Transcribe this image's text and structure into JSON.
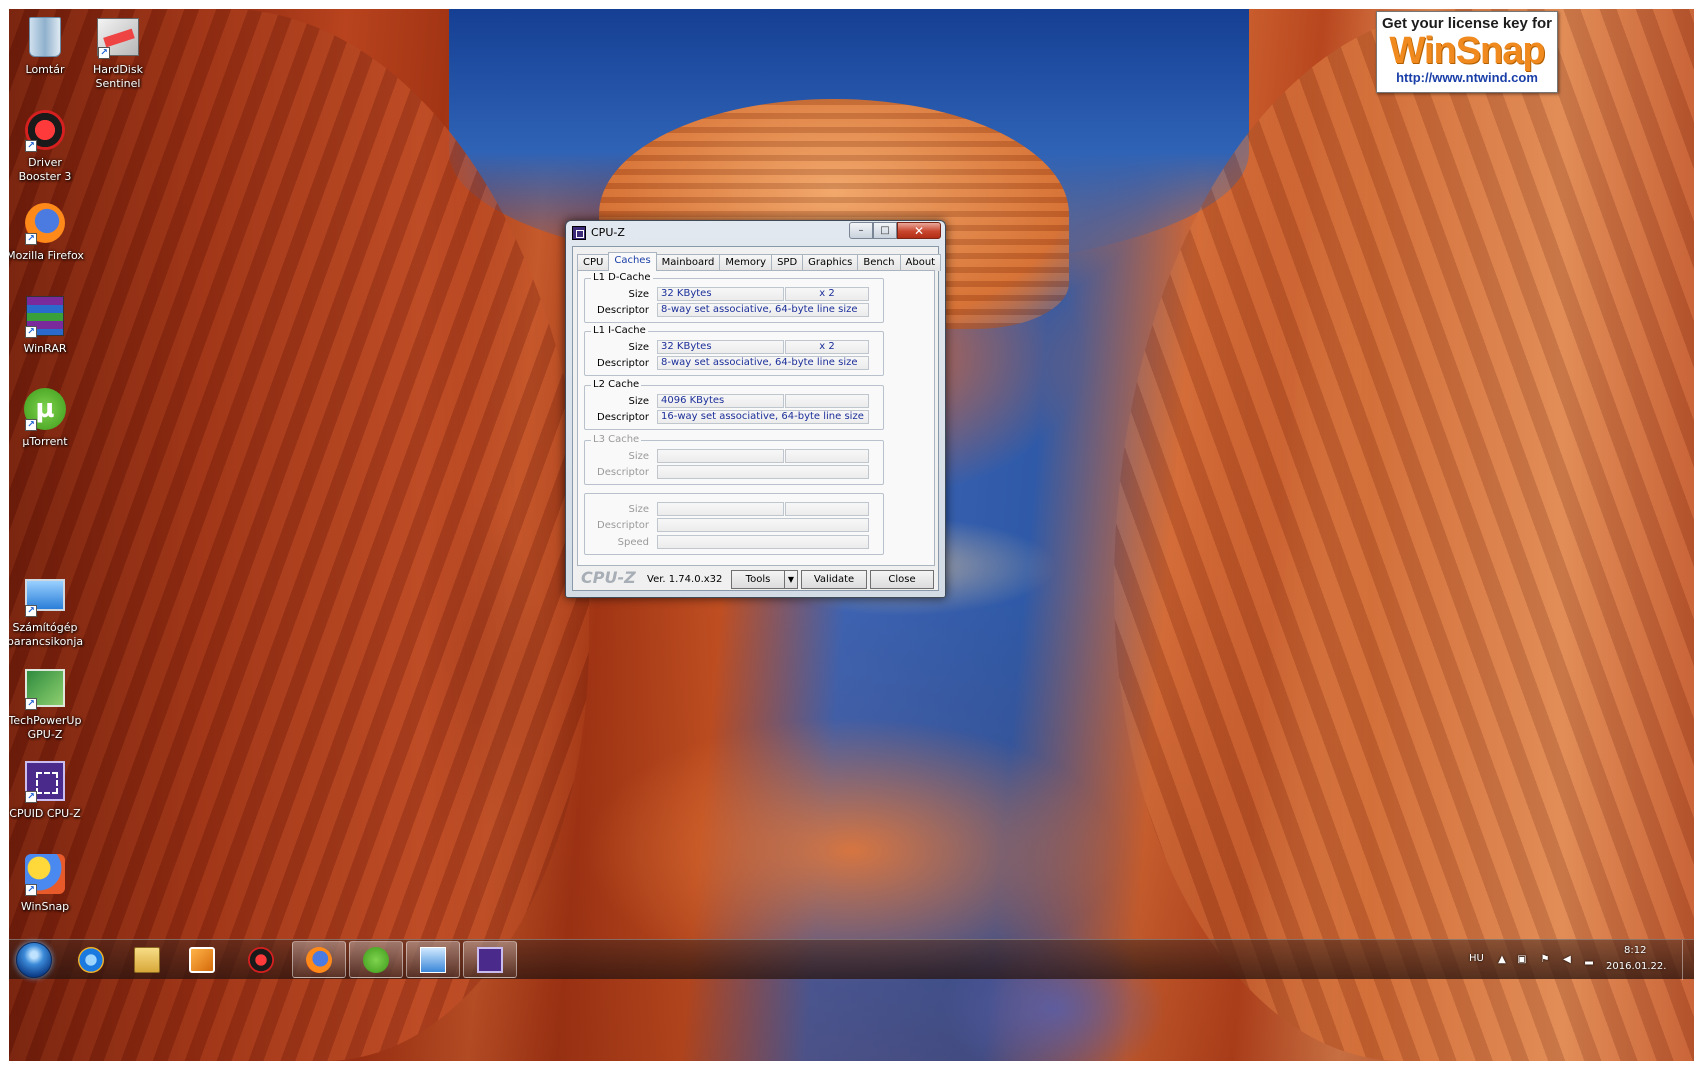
{
  "desktop": {
    "icons": [
      {
        "label": "Lomtár",
        "icon": "recycle-bin-icon"
      },
      {
        "label": "HardDisk Sentinel",
        "icon": "harddisk-sentinel-icon"
      },
      {
        "label": "Driver Booster 3",
        "icon": "driver-booster-icon"
      },
      {
        "label": "Mozilla Firefox",
        "icon": "firefox-icon"
      },
      {
        "label": "WinRAR",
        "icon": "winrar-icon"
      },
      {
        "label": "µTorrent",
        "icon": "utorrent-icon"
      },
      {
        "label": "Számítógép parancsikonja",
        "icon": "computer-icon"
      },
      {
        "label": "TechPowerUp GPU-Z",
        "icon": "gpu-z-icon"
      },
      {
        "label": "CPUID CPU-Z",
        "icon": "cpu-z-icon"
      },
      {
        "label": "WinSnap",
        "icon": "winsnap-icon"
      }
    ]
  },
  "ad": {
    "top": "Get your license key for",
    "brand": "WinSnap",
    "url": "http://www.ntwind.com"
  },
  "cpuz": {
    "title": "CPU-Z",
    "window_buttons": {
      "minimize": "–",
      "maximize": "□",
      "close": "✕"
    },
    "tabs": [
      "CPU",
      "Caches",
      "Mainboard",
      "Memory",
      "SPD",
      "Graphics",
      "Bench",
      "About"
    ],
    "active_tab": "Caches",
    "groups": {
      "l1d": {
        "label": "L1 D-Cache",
        "size_label": "Size",
        "size": "32 KBytes",
        "multiplier": "x 2",
        "descriptor_label": "Descriptor",
        "descriptor": "8-way set associative, 64-byte line size"
      },
      "l1i": {
        "label": "L1 I-Cache",
        "size_label": "Size",
        "size": "32 KBytes",
        "multiplier": "x 2",
        "descriptor_label": "Descriptor",
        "descriptor": "8-way set associative, 64-byte line size"
      },
      "l2": {
        "label": "L2 Cache",
        "size_label": "Size",
        "size": "4096 KBytes",
        "multiplier": "",
        "descriptor_label": "Descriptor",
        "descriptor": "16-way set associative, 64-byte line size"
      },
      "l3": {
        "label": "L3 Cache",
        "size_label": "Size",
        "size": "",
        "multiplier": "",
        "descriptor_label": "Descriptor",
        "descriptor": ""
      },
      "extra": {
        "size_label": "Size",
        "descriptor_label": "Descriptor",
        "speed_label": "Speed"
      }
    },
    "footer": {
      "brand": "CPU-Z",
      "version": "Ver. 1.74.0.x32",
      "tools": "Tools",
      "tools_dropdown": "▼",
      "validate": "Validate",
      "close": "Close"
    }
  },
  "taskbar": {
    "pinned": [
      {
        "name": "internet-explorer-icon"
      },
      {
        "name": "file-explorer-icon"
      },
      {
        "name": "media-player-icon"
      },
      {
        "name": "driver-booster-icon"
      },
      {
        "name": "firefox-icon"
      },
      {
        "name": "utorrent-icon"
      },
      {
        "name": "remote-desktop-icon"
      },
      {
        "name": "cpu-z-icon"
      }
    ],
    "tray": {
      "language": "HU",
      "time": "8:12",
      "date": "2016.01.22."
    }
  }
}
